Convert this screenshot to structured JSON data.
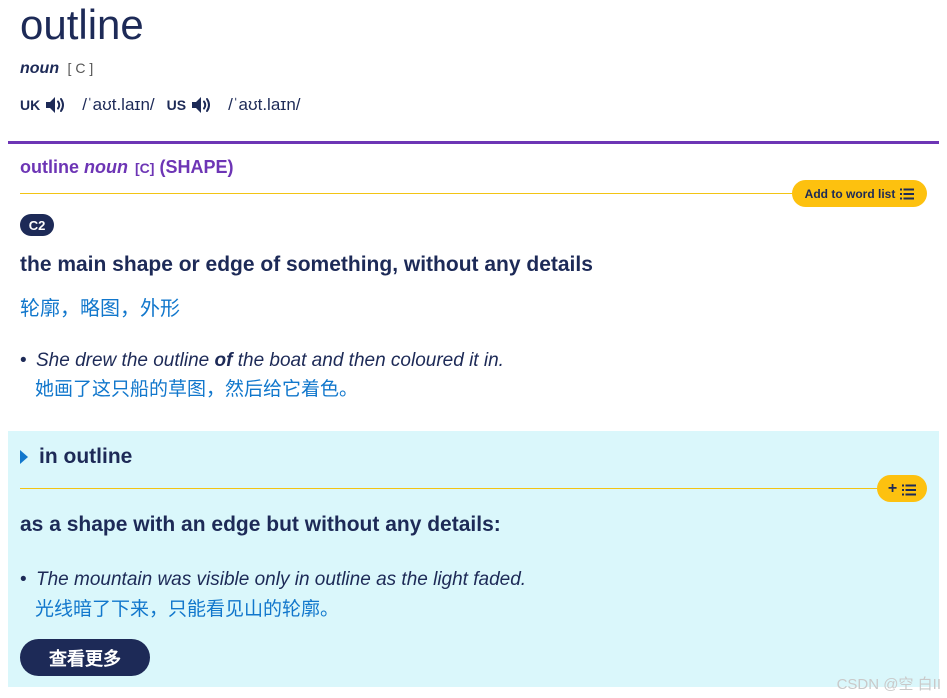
{
  "entry": {
    "headword": "outline",
    "pos": "noun",
    "grammar": "[ C ]",
    "pronunciations": {
      "uk_label": "UK",
      "uk_ipa": "/ˈaʊt.laɪn/",
      "us_label": "US",
      "us_ipa": "/ˈaʊt.laɪn/"
    }
  },
  "sense": {
    "headword": "outline",
    "pos": "noun",
    "grammar": "[C]",
    "guideword": "(SHAPE)",
    "add_to_word_list_label": "Add to word list",
    "level": "C2",
    "definition": "the main shape or edge of something, without any details",
    "translation": "轮廓，略图，外形",
    "example": {
      "before": "She drew the outline ",
      "bold": "of",
      "after": " the boat and then coloured it in.",
      "translation": "她画了这只船的草图，然后给它着色。"
    }
  },
  "idiom": {
    "phrase": "in outline",
    "add_button_label": "+",
    "definition": "as a shape with an edge but without any details:",
    "example": {
      "text": "The mountain was visible only in outline as the light faded.",
      "translation": "光线暗了下来，只能看见山的轮廓。"
    }
  },
  "more_button_label": "查看更多",
  "watermark": "CSDN @空 白II",
  "colors": {
    "navy": "#1d2a57",
    "purple": "#6d35b5",
    "yellow": "#fdc10f",
    "blue": "#1177cc",
    "idiom_bg": "#daf7fb"
  },
  "icons": {
    "speaker": "speaker-icon",
    "list": "word-list-icon",
    "caret": "caret-right-icon"
  }
}
